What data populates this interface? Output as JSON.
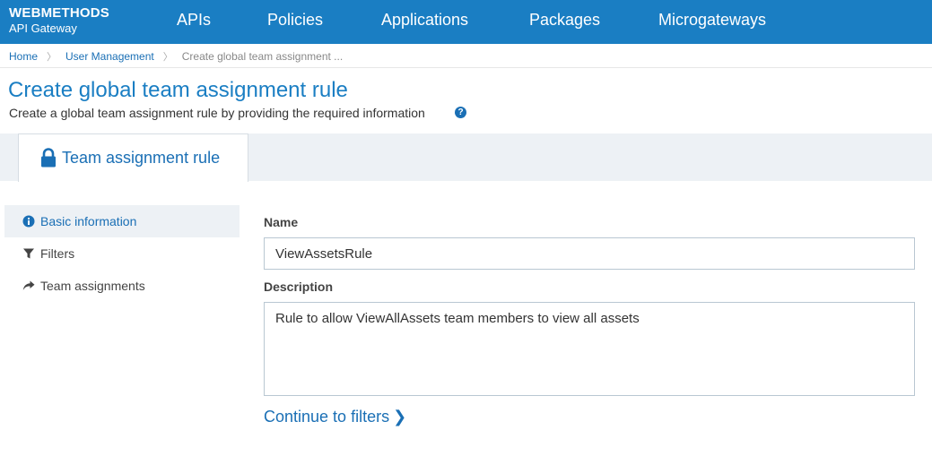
{
  "brand": {
    "name": "WEBMETHODS",
    "product": "API Gateway"
  },
  "nav": {
    "items": [
      {
        "label": "APIs"
      },
      {
        "label": "Policies"
      },
      {
        "label": "Applications"
      },
      {
        "label": "Packages"
      },
      {
        "label": "Microgateways"
      }
    ]
  },
  "breadcrumb": {
    "items": [
      "Home",
      "User Management"
    ],
    "current": "Create global team assignment ..."
  },
  "page": {
    "title": "Create global team assignment rule",
    "subtitle": "Create a global team assignment rule by providing the required information"
  },
  "tab": {
    "label": "Team assignment rule"
  },
  "sidenav": {
    "items": [
      {
        "label": "Basic information",
        "icon": "info-icon",
        "active": true
      },
      {
        "label": "Filters",
        "icon": "filter-icon",
        "active": false
      },
      {
        "label": "Team assignments",
        "icon": "share-arrow-icon",
        "active": false
      }
    ]
  },
  "form": {
    "name_label": "Name",
    "name_value": "ViewAssetsRule",
    "description_label": "Description",
    "description_value": "Rule to allow ViewAllAssets team members to view all assets"
  },
  "continue": {
    "label": "Continue to filters"
  },
  "colors": {
    "primary": "#1a7ec3",
    "link": "#1a6fb5",
    "panel": "#edf1f5"
  }
}
